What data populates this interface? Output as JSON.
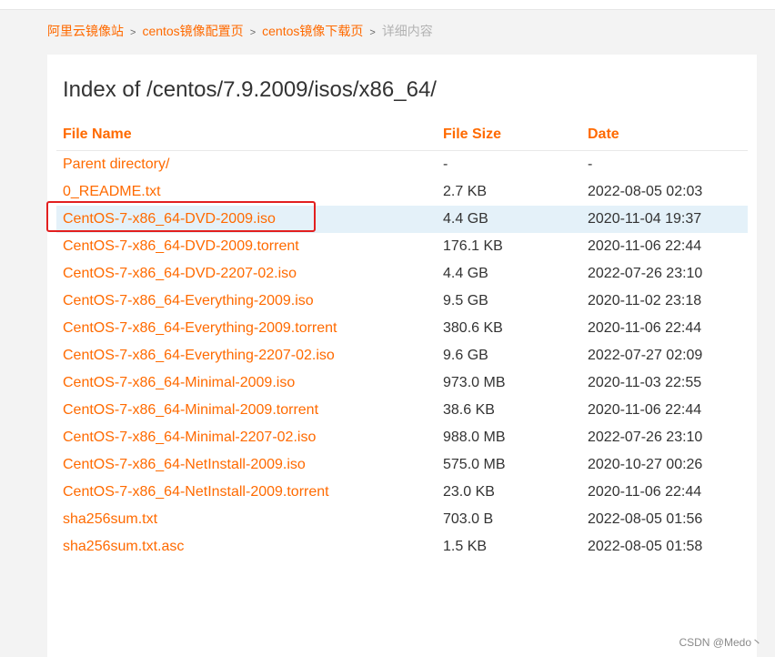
{
  "breadcrumb": {
    "items": [
      "阿里云镜像站",
      "centos镜像配置页",
      "centos镜像下载页"
    ],
    "current": "详细内容",
    "separator": ">"
  },
  "page": {
    "title": "Index of /centos/7.9.2009/isos/x86_64/"
  },
  "table": {
    "headers": {
      "name": "File Name",
      "size": "File Size",
      "date": "Date"
    },
    "rows": [
      {
        "name": "Parent directory/",
        "size": "-",
        "date": "-"
      },
      {
        "name": "0_README.txt",
        "size": "2.7 KB",
        "date": "2022-08-05 02:03"
      },
      {
        "name": "CentOS-7-x86_64-DVD-2009.iso",
        "size": "4.4 GB",
        "date": "2020-11-04 19:37"
      },
      {
        "name": "CentOS-7-x86_64-DVD-2009.torrent",
        "size": "176.1 KB",
        "date": "2020-11-06 22:44"
      },
      {
        "name": "CentOS-7-x86_64-DVD-2207-02.iso",
        "size": "4.4 GB",
        "date": "2022-07-26 23:10"
      },
      {
        "name": "CentOS-7-x86_64-Everything-2009.iso",
        "size": "9.5 GB",
        "date": "2020-11-02 23:18"
      },
      {
        "name": "CentOS-7-x86_64-Everything-2009.torrent",
        "size": "380.6 KB",
        "date": "2020-11-06 22:44"
      },
      {
        "name": "CentOS-7-x86_64-Everything-2207-02.iso",
        "size": "9.6 GB",
        "date": "2022-07-27 02:09"
      },
      {
        "name": "CentOS-7-x86_64-Minimal-2009.iso",
        "size": "973.0 MB",
        "date": "2020-11-03 22:55"
      },
      {
        "name": "CentOS-7-x86_64-Minimal-2009.torrent",
        "size": "38.6 KB",
        "date": "2020-11-06 22:44"
      },
      {
        "name": "CentOS-7-x86_64-Minimal-2207-02.iso",
        "size": "988.0 MB",
        "date": "2022-07-26 23:10"
      },
      {
        "name": "CentOS-7-x86_64-NetInstall-2009.iso",
        "size": "575.0 MB",
        "date": "2020-10-27 00:26"
      },
      {
        "name": "CentOS-7-x86_64-NetInstall-2009.torrent",
        "size": "23.0 KB",
        "date": "2020-11-06 22:44"
      },
      {
        "name": "sha256sum.txt",
        "size": "703.0 B",
        "date": "2022-08-05 01:56"
      },
      {
        "name": "sha256sum.txt.asc",
        "size": "1.5 KB",
        "date": "2022-08-05 01:58"
      }
    ]
  },
  "watermark": "CSDN @Medo丶",
  "colors": {
    "accent": "#ff6a00",
    "selected_row": "#e4f1f9",
    "annotation_box": "#e21f1f"
  }
}
